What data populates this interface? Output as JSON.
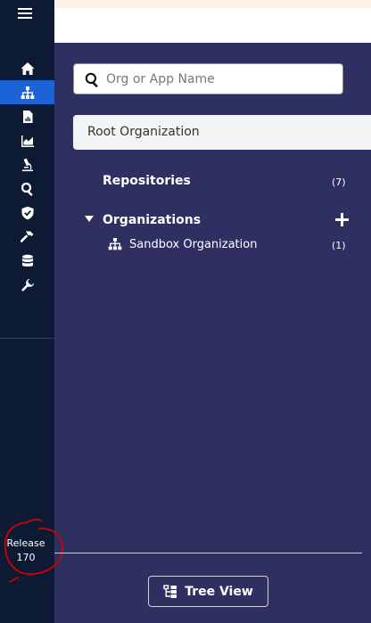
{
  "sidebar": {
    "menu_icon": "hamburger-icon",
    "items": [
      {
        "icon": "home-icon",
        "active": false
      },
      {
        "icon": "org-hierarchy-icon",
        "active": true
      },
      {
        "icon": "report-icon",
        "active": false
      },
      {
        "icon": "area-chart-icon",
        "active": false
      },
      {
        "icon": "microscope-icon",
        "active": false
      },
      {
        "icon": "search-icon",
        "active": false
      },
      {
        "icon": "shield-check-icon",
        "active": false
      },
      {
        "icon": "hammer-icon",
        "active": false
      },
      {
        "icon": "database-icon",
        "active": false
      },
      {
        "icon": "wrench-icon",
        "active": false
      }
    ],
    "release_label": "Release",
    "release_number": "170",
    "annotation_color": "#d40000"
  },
  "search": {
    "placeholder": "Org or App Name",
    "value": ""
  },
  "tree": {
    "root_label": "Root Organization",
    "repositories_label": "Repositories",
    "repositories_count": "(7)",
    "organizations_label": "Organizations",
    "children": [
      {
        "label": "Sandbox Organization",
        "count": "(1)"
      }
    ]
  },
  "footer": {
    "tree_view_label": "Tree View"
  },
  "colors": {
    "rail_bg": "#0d1a33",
    "panel_bg": "#2f3061",
    "active_item": "#1d63d6",
    "root_row_bg": "#f3f4f6"
  }
}
